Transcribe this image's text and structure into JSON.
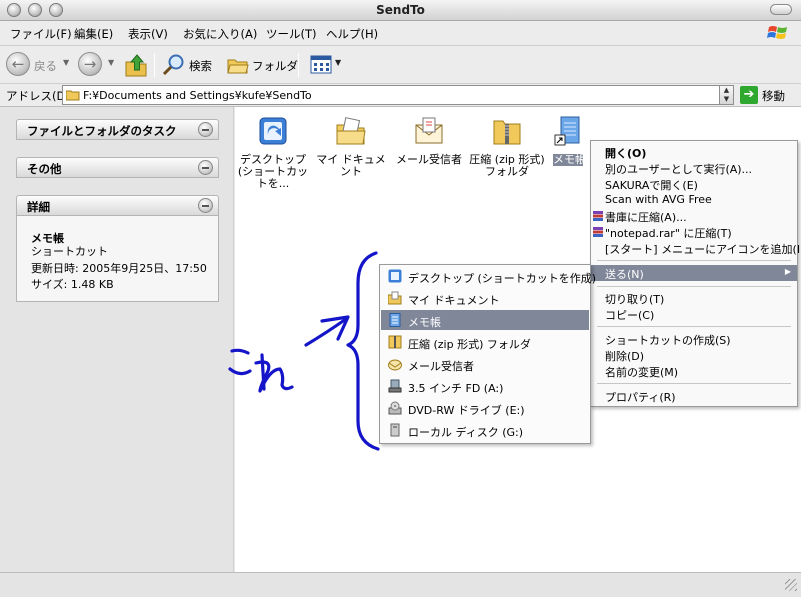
{
  "window": {
    "title": "SendTo"
  },
  "menubar": {
    "items": [
      "ファイル(F)",
      "編集(E)",
      "表示(V)",
      "お気に入り(A)",
      "ツール(T)",
      "ヘルプ(H)"
    ]
  },
  "toolbar": {
    "back_label": "戻る",
    "search_label": "検索",
    "folders_label": "フォルダ"
  },
  "address": {
    "label": "アドレス(D)",
    "path": "F:¥Documents and Settings¥kufe¥SendTo",
    "go_label": "移動"
  },
  "taskpane": {
    "panels": [
      {
        "title": "ファイルとフォルダのタスク"
      },
      {
        "title": "その他"
      },
      {
        "title": "詳細"
      }
    ],
    "details": {
      "name": "メモ帳",
      "type": "ショートカット",
      "modified": "更新日時: 2005年9月25日、17:50",
      "size": "サイズ: 1.48 KB"
    }
  },
  "files": [
    {
      "label": "デスクトップ (ショートカットを...",
      "icon": "desktop-shortcut-icon"
    },
    {
      "label": "マイ ドキュメント",
      "icon": "my-documents-icon"
    },
    {
      "label": "メール受信者",
      "icon": "mail-recipient-icon"
    },
    {
      "label": "圧縮 (zip 形式) フォルダ",
      "icon": "zip-folder-icon"
    },
    {
      "label": "メモ帳",
      "icon": "notepad-icon"
    }
  ],
  "context_menu": {
    "open": "開く(O)",
    "run_as": "別のユーザーとして実行(A)...",
    "sakura": "SAKURAで開く(E)",
    "avg": "Scan with AVG Free",
    "compress": "書庫に圧縮(A)...",
    "compress_rar": "\"notepad.rar\" に圧縮(T)",
    "pin_start": "[スタート] メニューにアイコンを追加(I)",
    "send_to": "送る(N)",
    "cut": "切り取り(T)",
    "copy": "コピー(C)",
    "create_shortcut": "ショートカットの作成(S)",
    "delete": "削除(D)",
    "rename": "名前の変更(M)",
    "properties": "プロパティ(R)"
  },
  "sendto_menu": [
    {
      "label": "デスクトップ (ショートカットを作成)",
      "icon": "desktop-icon"
    },
    {
      "label": "マイ ドキュメント",
      "icon": "my-documents-icon"
    },
    {
      "label": "メモ帳",
      "icon": "notepad-icon"
    },
    {
      "label": "圧縮 (zip 形式) フォルダ",
      "icon": "zip-folder-icon"
    },
    {
      "label": "メール受信者",
      "icon": "mail-icon"
    },
    {
      "label": "3.5 インチ FD (A:)",
      "icon": "floppy-icon"
    },
    {
      "label": "DVD-RW ドライブ (E:)",
      "icon": "dvd-drive-icon"
    },
    {
      "label": "ローカル ディスク (G:)",
      "icon": "local-disk-icon"
    }
  ],
  "annotation": {
    "handwriting": "これ",
    "color": "#1414c8"
  },
  "colors": {
    "highlight": "#7f8799",
    "go": "#2fa82f"
  }
}
